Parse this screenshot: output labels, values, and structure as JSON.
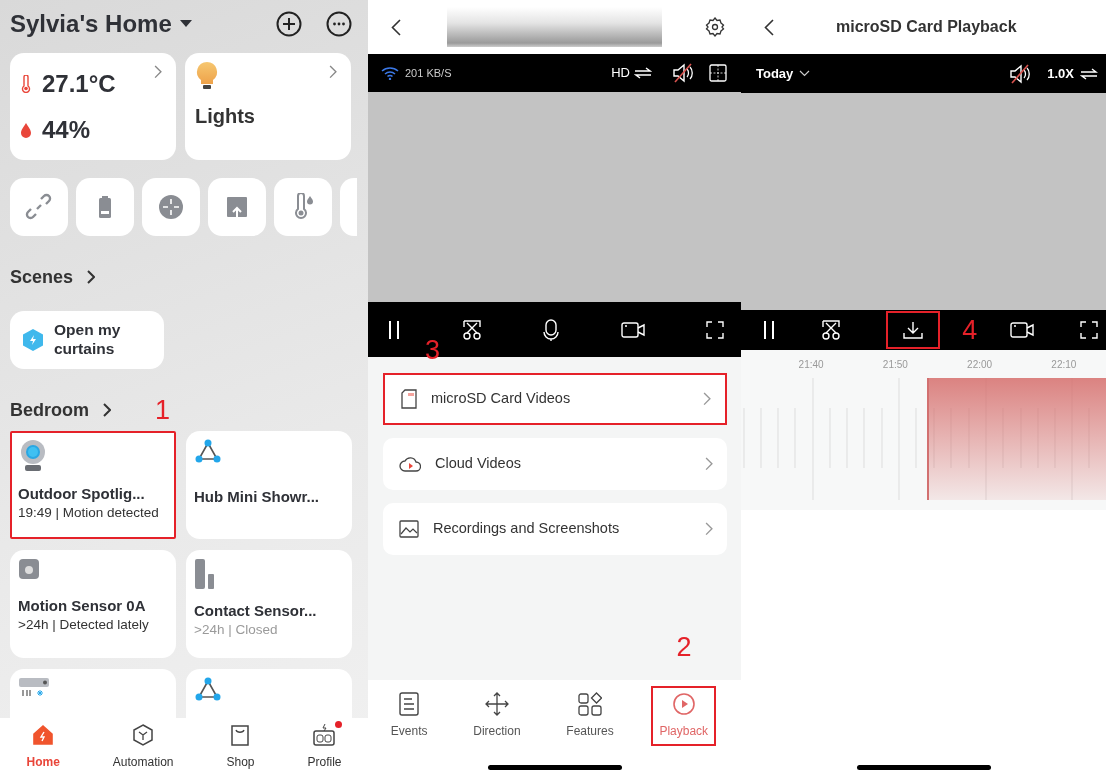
{
  "home": {
    "title": "Sylvia's Home",
    "temperature": "27.1°C",
    "humidity": "44%",
    "lights": "Lights",
    "scenes_heading": "Scenes",
    "scenes": [
      {
        "name": "Open my curtains"
      }
    ],
    "room_heading": "Bedroom",
    "devices": [
      {
        "kind": "camera",
        "name": "Outdoor Spotlig...",
        "status": "19:49 | Motion detected",
        "dimmed": false,
        "highlighted": true,
        "annotation": "1"
      },
      {
        "kind": "hub",
        "name": "Hub Mini Showr...",
        "highlighted": false
      },
      {
        "kind": "motion",
        "name": "Motion Sensor 0A",
        "status": ">24h | Detected lately",
        "dimmed": false,
        "highlighted": false
      },
      {
        "kind": "contact",
        "name": "Contact Sensor...",
        "status": ">24h | Closed",
        "dimmed": true,
        "highlighted": false
      },
      {
        "kind": "aircon",
        "highlighted": false
      },
      {
        "kind": "hub",
        "highlighted": false
      }
    ],
    "tabs": [
      {
        "label": "Home",
        "selected": true,
        "notification": false
      },
      {
        "label": "Automation",
        "selected": false,
        "notification": false
      },
      {
        "label": "Shop",
        "selected": false,
        "notification": false
      },
      {
        "label": "Profile",
        "selected": false,
        "notification": true
      }
    ]
  },
  "live": {
    "speed": "201 KB/S",
    "quality": "HD",
    "muted": true,
    "menu": [
      {
        "kind": "sdcard",
        "label": "microSD Card Videos",
        "highlighted": true,
        "annotation": "3"
      },
      {
        "kind": "cloud",
        "label": "Cloud Videos",
        "highlighted": false
      },
      {
        "kind": "gallery",
        "label": "Recordings and Screenshots",
        "highlighted": false
      }
    ],
    "tabs": [
      {
        "kind": "events",
        "label": "Events",
        "selected": false,
        "highlighted": false
      },
      {
        "kind": "direction",
        "label": "Direction",
        "selected": false,
        "highlighted": false
      },
      {
        "kind": "features",
        "label": "Features",
        "selected": false,
        "highlighted": false
      },
      {
        "kind": "playback",
        "label": "Playback",
        "selected": true,
        "highlighted": true,
        "annotation": "2"
      }
    ]
  },
  "playback": {
    "title": "microSD Card Playback",
    "date": "Today",
    "speed": "1.0X",
    "muted": true,
    "download": {
      "highlighted": true,
      "annotation": "4"
    },
    "timeline": {
      "labels": [
        "21:40",
        "21:50",
        "22:00",
        "22:10"
      ],
      "level": 0.49
    }
  }
}
